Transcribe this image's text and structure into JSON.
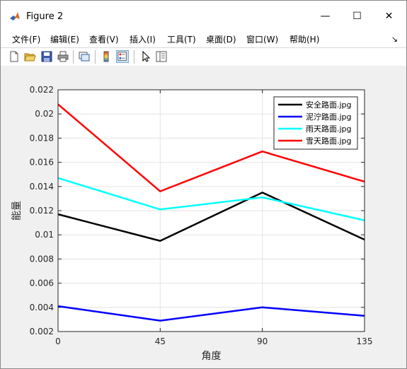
{
  "window": {
    "title": "Figure 2",
    "controls": {
      "minimize": "—",
      "maximize": "☐",
      "close": "✕"
    }
  },
  "menu": {
    "items": [
      "文件(F)",
      "编辑(E)",
      "查看(V)",
      "插入(I)",
      "工具(T)",
      "桌面(D)",
      "窗口(W)",
      "帮助(H)"
    ],
    "dock_arrow": "↘"
  },
  "toolbar": {
    "buttons": [
      "new-figure-icon",
      "open-folder-icon",
      "save-icon",
      "print-icon",
      "link-plot-icon",
      "colorbar-icon",
      "legend-icon",
      "cursor-icon",
      "property-inspector-icon"
    ]
  },
  "chart_data": {
    "type": "line",
    "x": [
      0,
      45,
      90,
      135
    ],
    "xlabel": "角度",
    "ylabel": "能量",
    "xlim": [
      0,
      135
    ],
    "ylim": [
      0.002,
      0.022
    ],
    "xticks": [
      "0",
      "45",
      "90",
      "135"
    ],
    "yticks": [
      "0.002",
      "0.004",
      "0.006",
      "0.008",
      "0.01",
      "0.012",
      "0.014",
      "0.016",
      "0.018",
      "0.02",
      "0.022"
    ],
    "ytick_values": [
      0.002,
      0.004,
      0.006,
      0.008,
      0.01,
      0.012,
      0.014,
      0.016,
      0.018,
      0.02,
      0.022
    ],
    "grid": true,
    "legend_position": "top-right",
    "series": [
      {
        "name": "安全路面.jpg",
        "color": "#000000",
        "values": [
          0.0117,
          0.0095,
          0.0135,
          0.0096
        ]
      },
      {
        "name": "泥泞路面.jpg",
        "color": "#0000ff",
        "values": [
          0.0041,
          0.0029,
          0.004,
          0.0033
        ]
      },
      {
        "name": "雨天路面.jpg",
        "color": "#00ffff",
        "values": [
          0.0147,
          0.0121,
          0.0131,
          0.0112
        ]
      },
      {
        "name": "雪天路面.jpg",
        "color": "#ff0000",
        "values": [
          0.0208,
          0.0136,
          0.0169,
          0.0144
        ]
      }
    ]
  }
}
